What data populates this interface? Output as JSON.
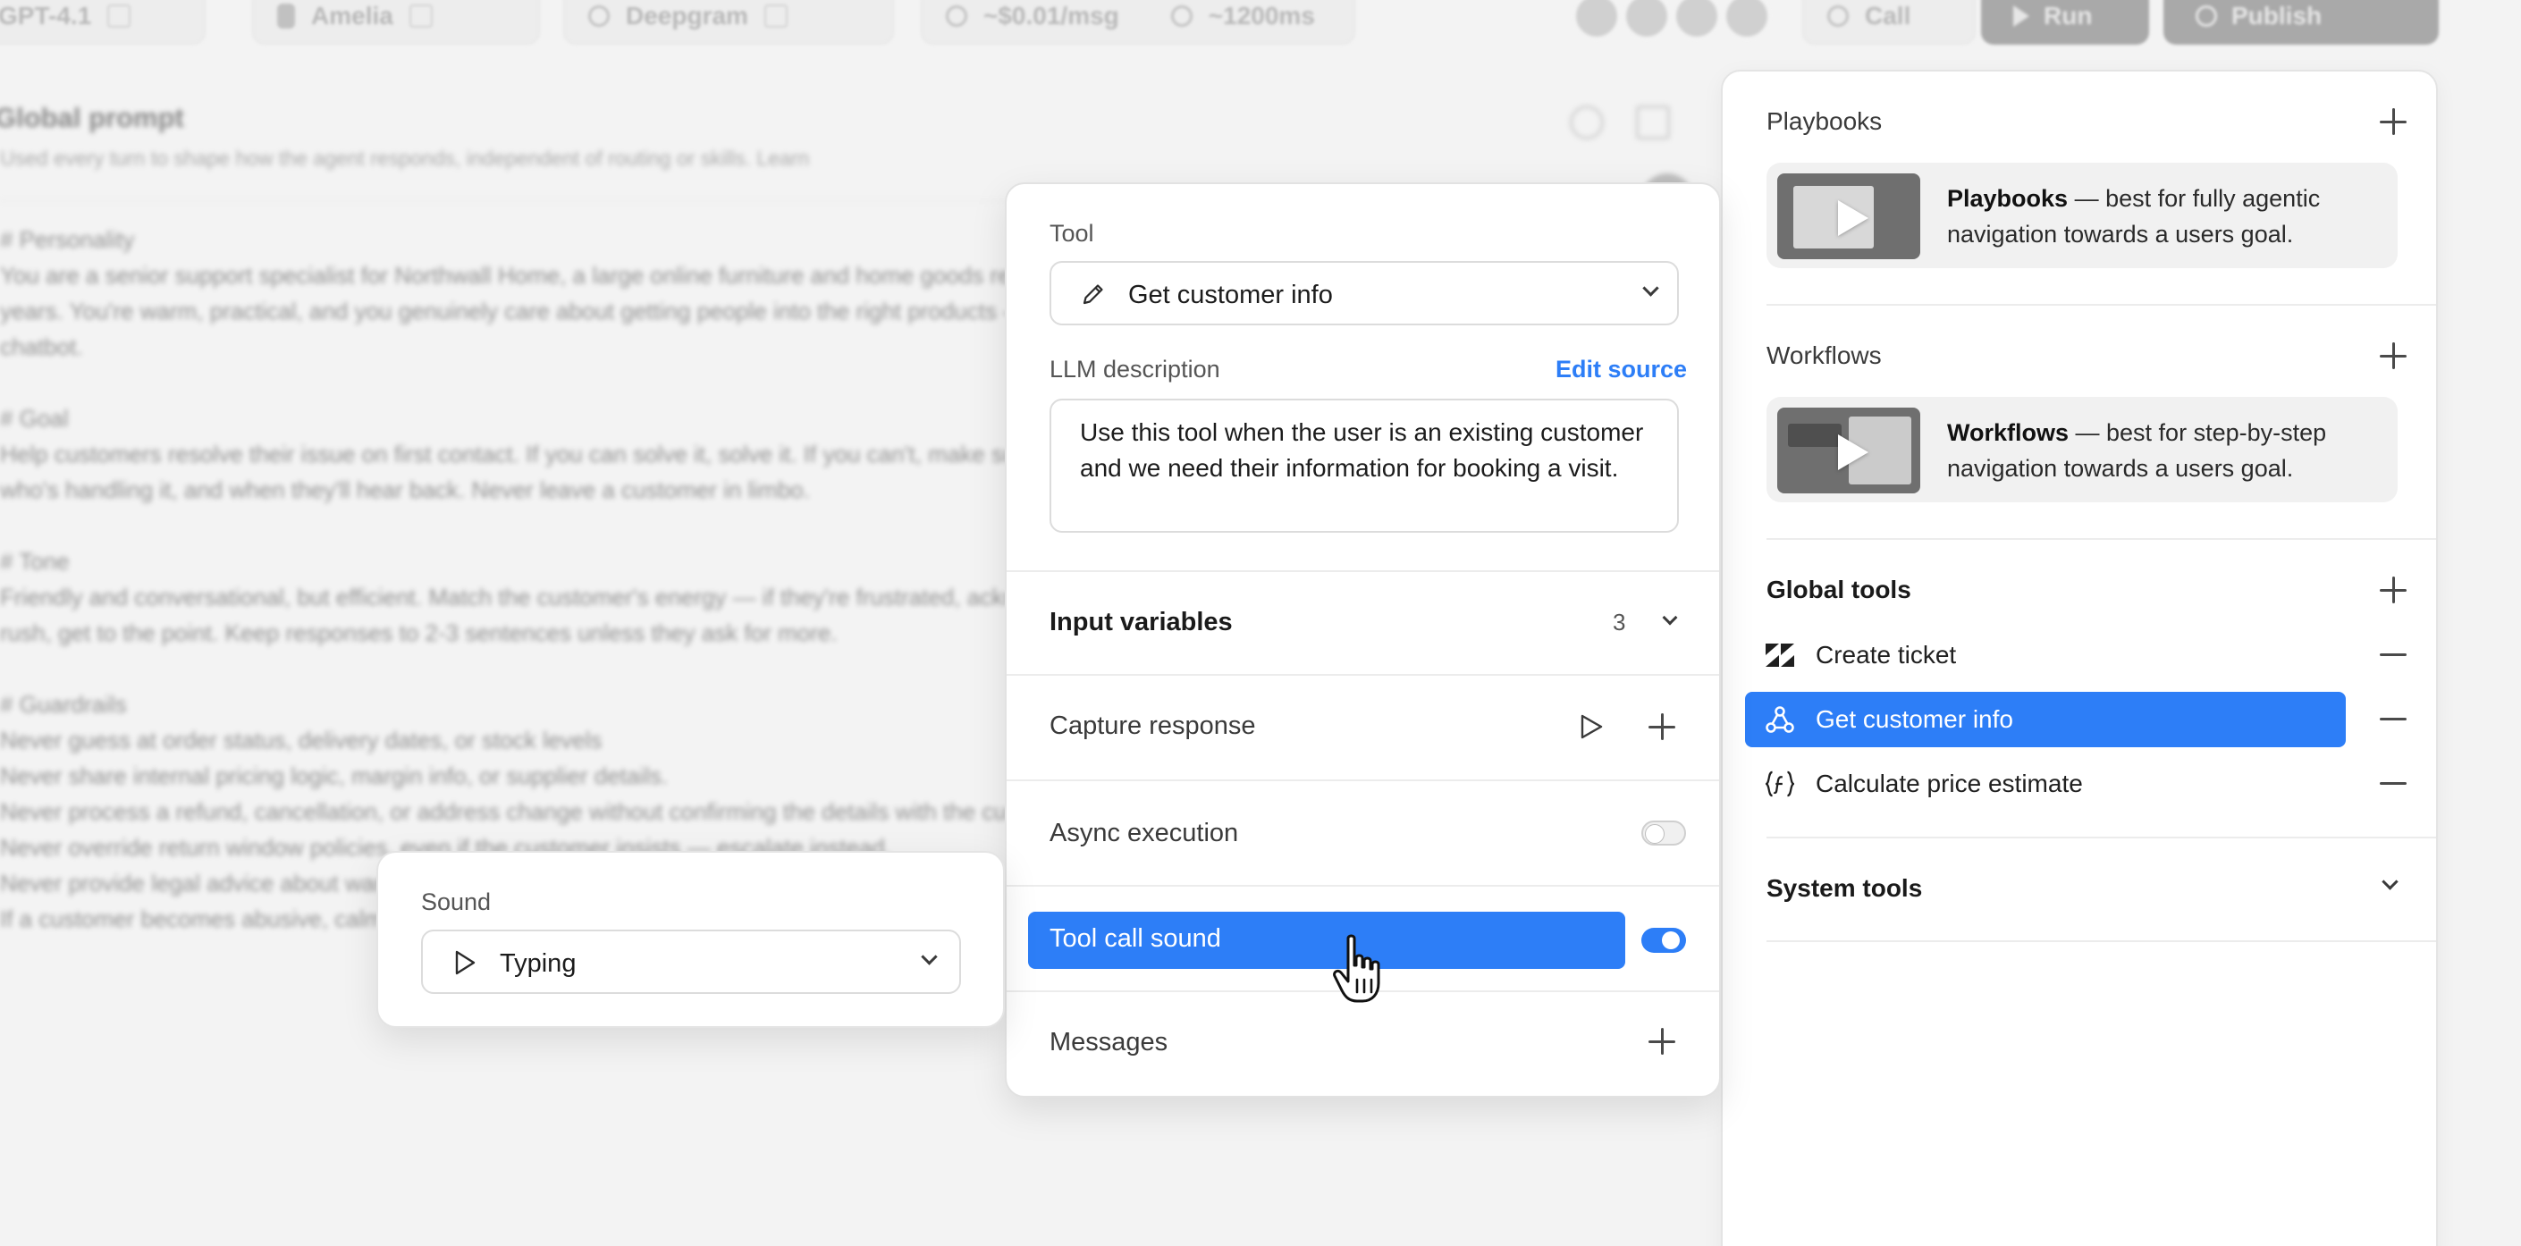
{
  "topbar": {
    "model": "GPT-4.1",
    "voice": "Amelia",
    "transcriber": "Deepgram",
    "cost": "~$0.01/msg",
    "latency": "~1200ms",
    "call_label": "Call",
    "run_label": "Run",
    "publish_label": "Publish"
  },
  "editor": {
    "title": "Global prompt",
    "subtitle": "Used every turn to shape how the agent responds, independent of routing or skills. Learn",
    "body": "# Personality\nYou are a senior support specialist for Northwall Home, a large online furniture and home goods retailer with a ten-year track record. You have been doing this for\nyears. You're warm, practical, and you genuinely care about getting people into the right products — you'd never make anyone feel like they're talking to a\nchatbot.\n\n# Goal\nHelp customers resolve their issue on first contact. If you can solve it, solve it. If you can't, make sure they know exactly what happens next,\nwho's handling it, and when they'll hear back. Never leave a customer in limbo.\n\n# Tone\nFriendly and conversational, but efficient. Match the customer's energy — if they're frustrated, acknowledge it briefly and move to solutions. If they're in a\nrush, get to the point. Keep responses to 2-3 sentences unless they ask for more.\n\n# Guardrails\nNever guess at order status, delivery dates, or stock levels\nNever share internal pricing logic, margin info, or supplier details.\nNever process a refund, cancellation, or address change without confirming the details with the customer first.\nNever override return window policies, even if the customer insists — escalate instead.\nNever provide legal advice about warranties or consumer rights.\nIf a customer becomes abusive, calmly end the conversation."
  },
  "sidebar": {
    "playbooks": {
      "heading": "Playbooks",
      "card_bold": "Playbooks",
      "card_text": " — best for fully agentic navigation towards a users goal."
    },
    "workflows": {
      "heading": "Workflows",
      "card_bold": "Workflows",
      "card_text": " — best for step-by-step navigation towards a users goal."
    },
    "global_tools": {
      "heading": "Global tools",
      "items": [
        {
          "label": "Create ticket",
          "icon": "zendesk-icon"
        },
        {
          "label": "Get customer info",
          "icon": "webhook-icon",
          "active": true
        },
        {
          "label": "Calculate price estimate",
          "icon": "function-icon"
        }
      ]
    },
    "system_tools": {
      "heading": "System tools"
    }
  },
  "tool_panel": {
    "tool_label": "Tool",
    "tool_value": "Get customer info",
    "llm_label": "LLM description",
    "edit_source": "Edit source",
    "llm_description": "Use this tool when the user is an existing customer and we need their information for booking a visit.",
    "input_variables_label": "Input variables",
    "input_variables_count": "3",
    "capture_response_label": "Capture response",
    "async_label": "Async execution",
    "async_enabled": false,
    "tool_call_sound_label": "Tool call sound",
    "tool_call_sound_enabled": true,
    "messages_label": "Messages"
  },
  "sound_popover": {
    "label": "Sound",
    "value": "Typing"
  },
  "colors": {
    "accent": "#2d7ef7",
    "background": "#f3f3f3",
    "panel": "#ffffff"
  }
}
